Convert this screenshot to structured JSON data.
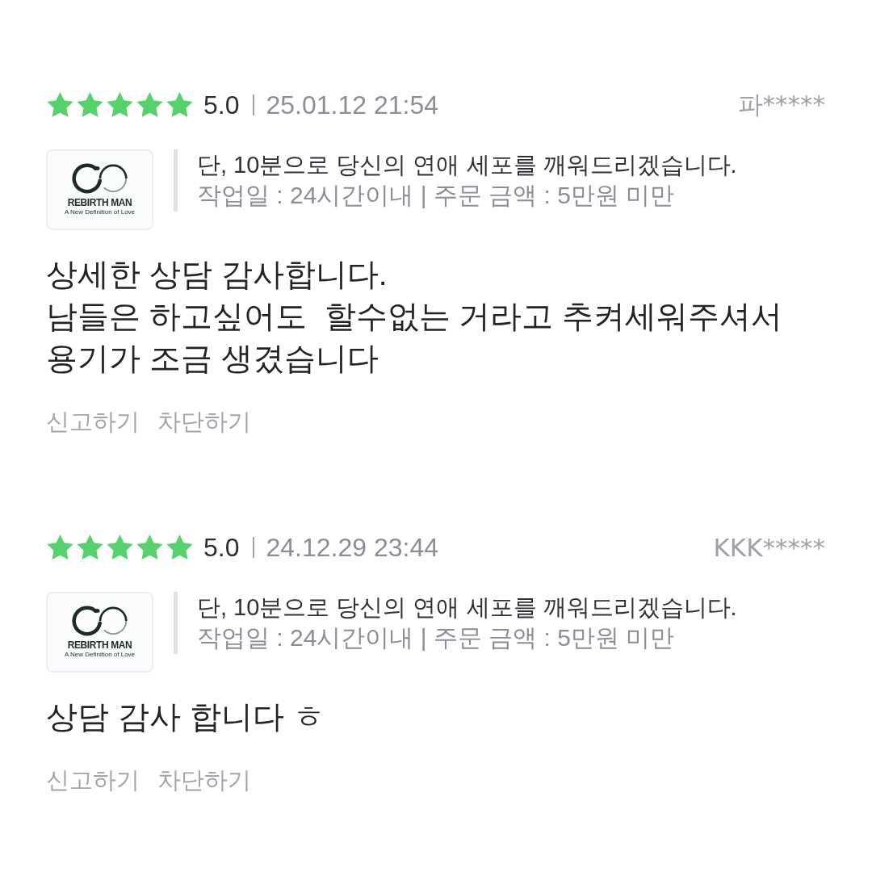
{
  "reviews": [
    {
      "stars": 5,
      "score": "5.0",
      "date": "25.01.12 21:54",
      "user": "파*****",
      "service": {
        "logo": {
          "name": "REBIRTH MAN",
          "tagline": "A New Definition of Love"
        },
        "title": "단, 10분으로 당신의 연애 세포를 깨워드리겠습니다.",
        "details": "작업일 : 24시간이내 | 주문 금액 : 5만원 미만"
      },
      "body": "상세한 상담 감사합니다.\n남들은 하고싶어도  할수없는 거라고 추켜세워주셔서\n용기가 조금 생겼습니다",
      "actions": [
        "신고하기",
        "차단하기"
      ]
    },
    {
      "stars": 5,
      "score": "5.0",
      "date": "24.12.29 23:44",
      "user": "KKK*****",
      "service": {
        "logo": {
          "name": "REBIRTH MAN",
          "tagline": "A New Definition of Love"
        },
        "title": "단, 10분으로 당신의 연애 세포를 깨워드리겠습니다.",
        "details": "작업일 : 24시간이내 | 주문 금액 : 5만원 미만"
      },
      "body": "상담 감사 합니다 ㅎ",
      "actions": [
        "신고하기",
        "차단하기"
      ]
    }
  ]
}
